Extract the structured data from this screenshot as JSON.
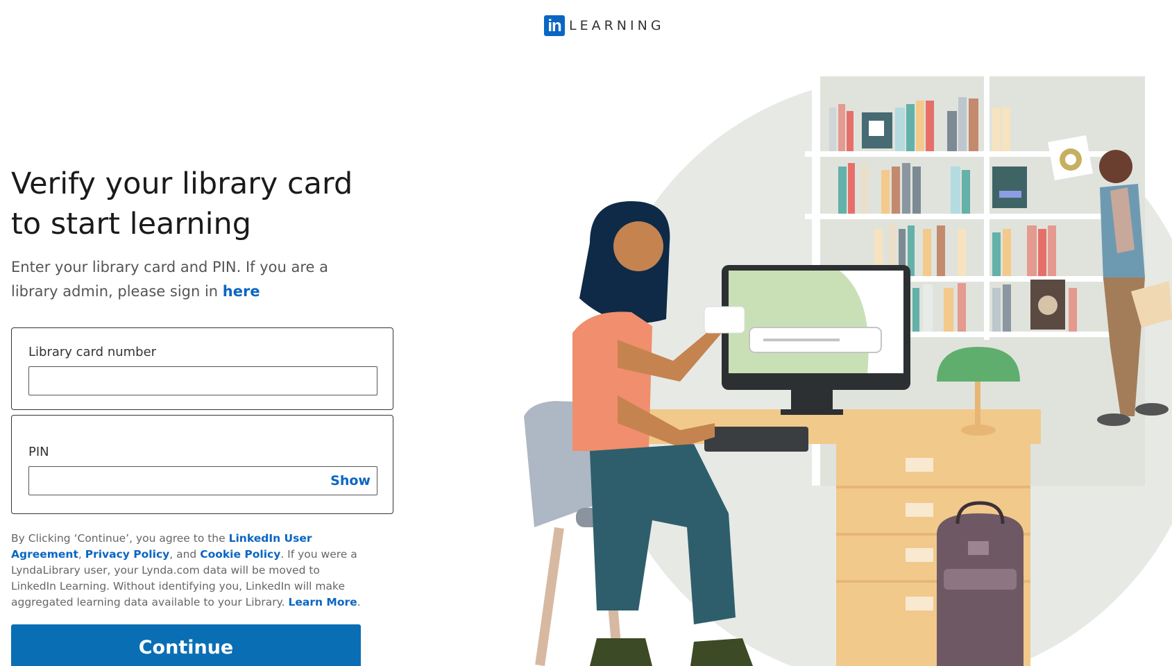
{
  "header": {
    "logo_mark": "in",
    "logo_text": "LEARNING"
  },
  "form": {
    "headline": "Verify your library card to start learning",
    "subtext_prefix": "Enter your library card and PIN. If you are a library admin, please sign in ",
    "subtext_link": "here",
    "card_number": {
      "label": "Library card number",
      "value": "",
      "placeholder": ""
    },
    "pin": {
      "label": "PIN",
      "value": "",
      "placeholder": "",
      "show_label": "Show"
    },
    "legal": {
      "part1": "By Clicking ‘Continue’, you agree to the ",
      "link_user_agreement": "LinkedIn User Agreement",
      "part2": ", ",
      "link_privacy": "Privacy Policy",
      "part3": ", and ",
      "link_cookie": "Cookie Policy",
      "part4": ". If you were a LyndaLibrary user, your Lynda.com data will be moved to LinkedIn Learning. Without identifying you, LinkedIn will make aggregated learning data available to your Library. ",
      "link_learn_more": "Learn More",
      "part5": "."
    },
    "continue_label": "Continue"
  },
  "colors": {
    "brand_blue": "#0a66c2",
    "button_blue": "#0a6eb4"
  }
}
